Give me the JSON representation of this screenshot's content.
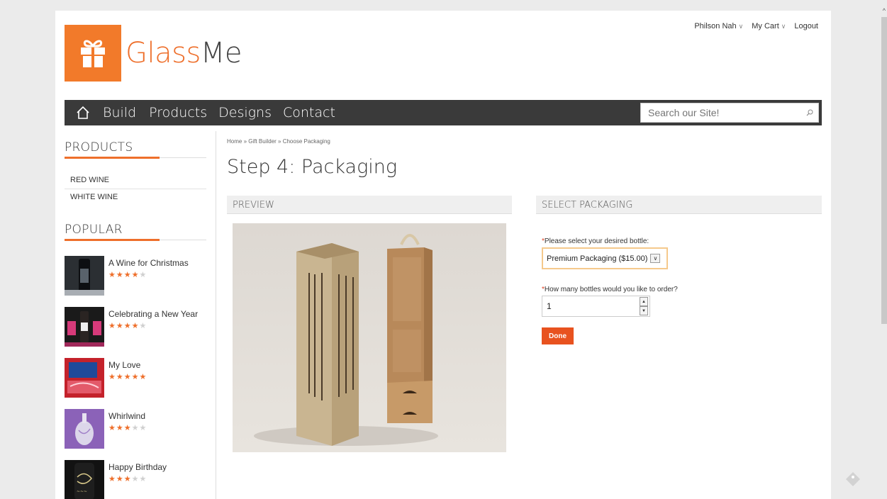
{
  "brand": {
    "name_part1": "Glass",
    "name_part2": "Me"
  },
  "userbar": {
    "user": "Philson Nah",
    "cart": "My Cart",
    "logout": "Logout"
  },
  "nav": {
    "items": [
      "Build",
      "Products",
      "Designs",
      "Contact"
    ],
    "search_placeholder": "Search our Site!"
  },
  "sidebar": {
    "products_heading": "PRODUCTS",
    "products": [
      "RED WINE",
      "WHITE WINE"
    ],
    "popular_heading": "POPULAR",
    "popular": [
      {
        "title": "A Wine for Christmas",
        "rating": 4,
        "max": 5
      },
      {
        "title": "Celebrating a New Year",
        "rating": 4,
        "max": 5
      },
      {
        "title": "My Love",
        "rating": 5,
        "max": 5
      },
      {
        "title": "Whirlwind",
        "rating": 3,
        "max": 5
      },
      {
        "title": "Happy Birthday",
        "rating": 3,
        "max": 5
      }
    ]
  },
  "main": {
    "breadcrumb": "Home » Gift Builder » Choose Packaging",
    "title": "Step 4: Packaging",
    "preview_heading": "PREVIEW",
    "select_heading": "SELECT PACKAGING",
    "bottle_label": "Please select your desired bottle:",
    "bottle_value": "Premium Packaging ($15.00)",
    "qty_label": "How many bottles would you like to order?",
    "qty_value": "1",
    "required_mark": "*",
    "done_label": "Done"
  },
  "colors": {
    "accent": "#ee6f2b",
    "nav": "#3a3a3a",
    "button": "#e8521f"
  }
}
